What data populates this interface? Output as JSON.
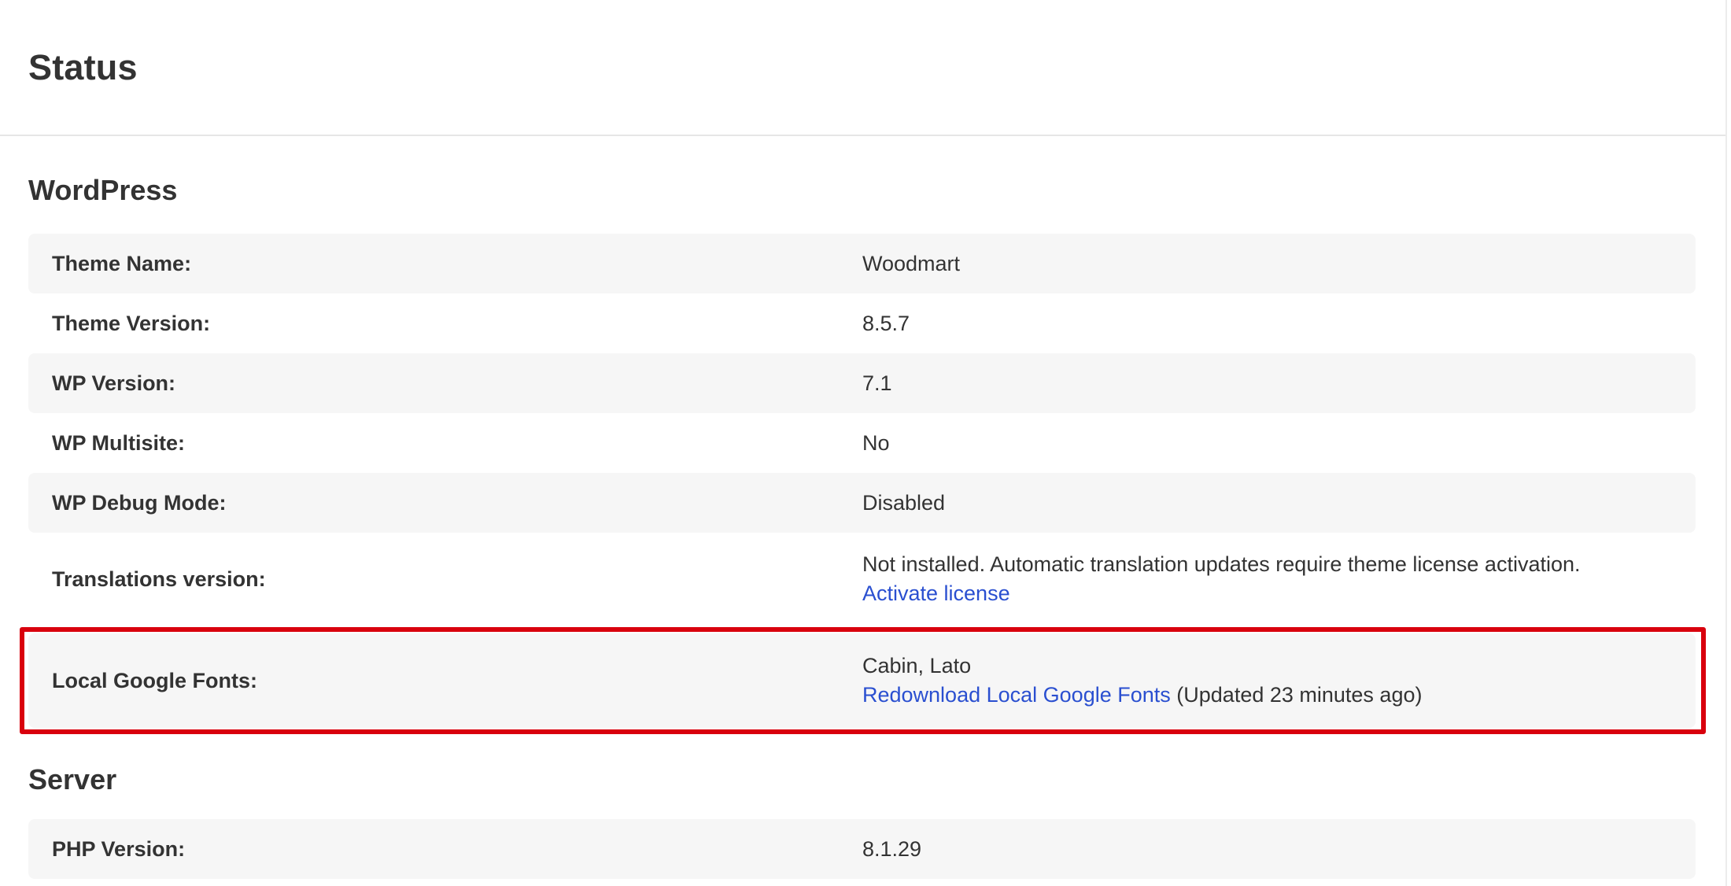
{
  "page": {
    "title": "Status"
  },
  "wordpress": {
    "title": "WordPress",
    "theme_name_label": "Theme Name:",
    "theme_name_value": "Woodmart",
    "theme_version_label": "Theme Version:",
    "theme_version_value": "8.5.7",
    "wp_version_label": "WP Version:",
    "wp_version_value": "7.1",
    "wp_multisite_label": "WP Multisite:",
    "wp_multisite_value": "No",
    "wp_debug_label": "WP Debug Mode:",
    "wp_debug_value": "Disabled",
    "translations_label": "Translations version:",
    "translations_value": "Not installed. Automatic translation updates require theme license activation.",
    "translations_link": "Activate license",
    "fonts_label": "Local Google Fonts:",
    "fonts_value": "Cabin, Lato",
    "fonts_link": "Redownload Local Google Fonts",
    "fonts_updated": "(Updated 23 minutes ago)"
  },
  "server": {
    "title": "Server",
    "php_version_label": "PHP Version:",
    "php_version_value": "8.1.29"
  },
  "colors": {
    "link": "#2a4fd0",
    "highlight": "#d9000d",
    "row_alt": "#f6f6f6"
  }
}
